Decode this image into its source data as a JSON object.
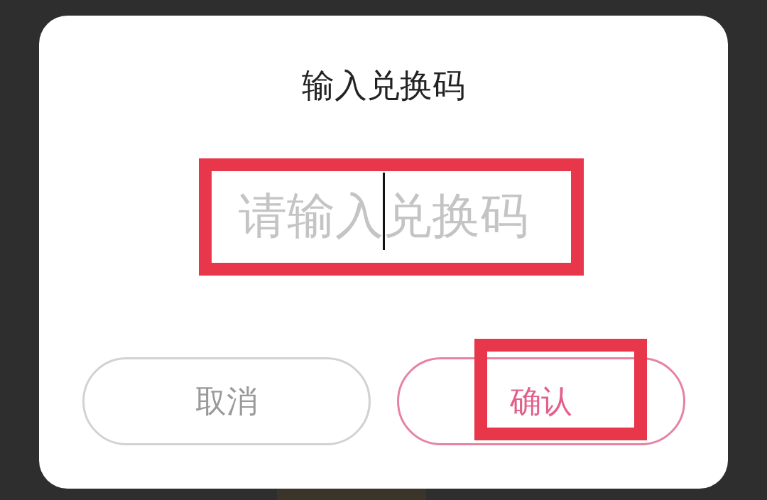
{
  "dialog": {
    "title": "输入兑换码",
    "code_field": {
      "placeholder": "请输入兑换码",
      "focused": true,
      "highlighted": true
    },
    "buttons": [
      {
        "label": "取消",
        "kind": "cancel",
        "highlighted": false
      },
      {
        "label": "确认",
        "kind": "confirm",
        "highlighted": true
      }
    ]
  }
}
